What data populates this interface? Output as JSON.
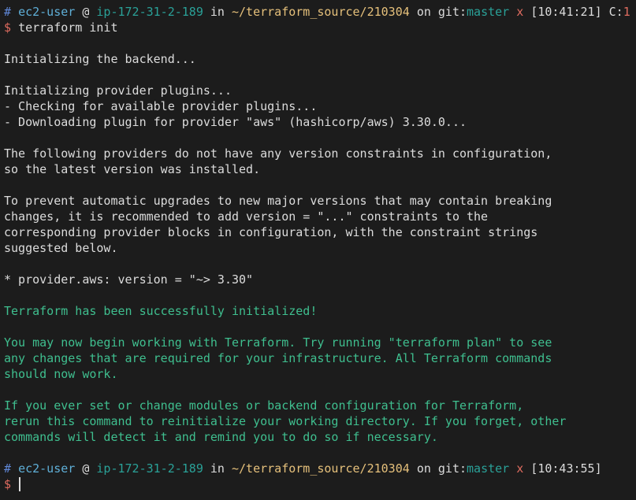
{
  "prompt1": {
    "hash": "#",
    "user": "ec2-user",
    "at": "@",
    "host": "ip-172-31-2-189",
    "in": "in",
    "path": "~/terraform_source/210304",
    "on": "on",
    "git_label": "git:",
    "branch": "master",
    "dirty": "x",
    "time": "[10:41:21]",
    "code_label": "C:",
    "code": "1"
  },
  "command1": {
    "dollar": "$",
    "text": "terraform init"
  },
  "output": {
    "backend": "Initializing the backend...",
    "plugins": "Initializing provider plugins...",
    "checking": "- Checking for available provider plugins...",
    "downloading": "- Downloading plugin for provider \"aws\" (hashicorp/aws) 3.30.0...",
    "constraints": [
      "The following providers do not have any version constraints in configuration,",
      "so the latest version was installed."
    ],
    "prevent": [
      "To prevent automatic upgrades to new major versions that may contain breaking",
      "changes, it is recommended to add version = \"...\" constraints to the",
      "corresponding provider blocks in configuration, with the constraint strings",
      "suggested below."
    ],
    "provider_version": "* provider.aws: version = \"~> 3.30\"",
    "success": "Terraform has been successfully initialized!",
    "may_now": [
      "You may now begin working with Terraform. Try running \"terraform plan\" to see",
      "any changes that are required for your infrastructure. All Terraform commands",
      "should now work."
    ],
    "if_ever": [
      "If you ever set or change modules or backend configuration for Terraform,",
      "rerun this command to reinitialize your working directory. If you forget, other",
      "commands will detect it and remind you to do so if necessary."
    ]
  },
  "prompt2": {
    "hash": "#",
    "user": "ec2-user",
    "at": "@",
    "host": "ip-172-31-2-189",
    "in": "in",
    "path": "~/terraform_source/210304",
    "on": "on",
    "git_label": "git:",
    "branch": "master",
    "dirty": "x",
    "time": "[10:43:55]"
  },
  "command2": {
    "dollar": "$",
    "text": ""
  },
  "colors": {
    "background": "#1c1c1c",
    "text": "#dcdcdc",
    "user": "#5fafd7",
    "host": "#2aa198",
    "path": "#e5c07b",
    "error": "#e06c60",
    "success": "#3fbf8f"
  }
}
